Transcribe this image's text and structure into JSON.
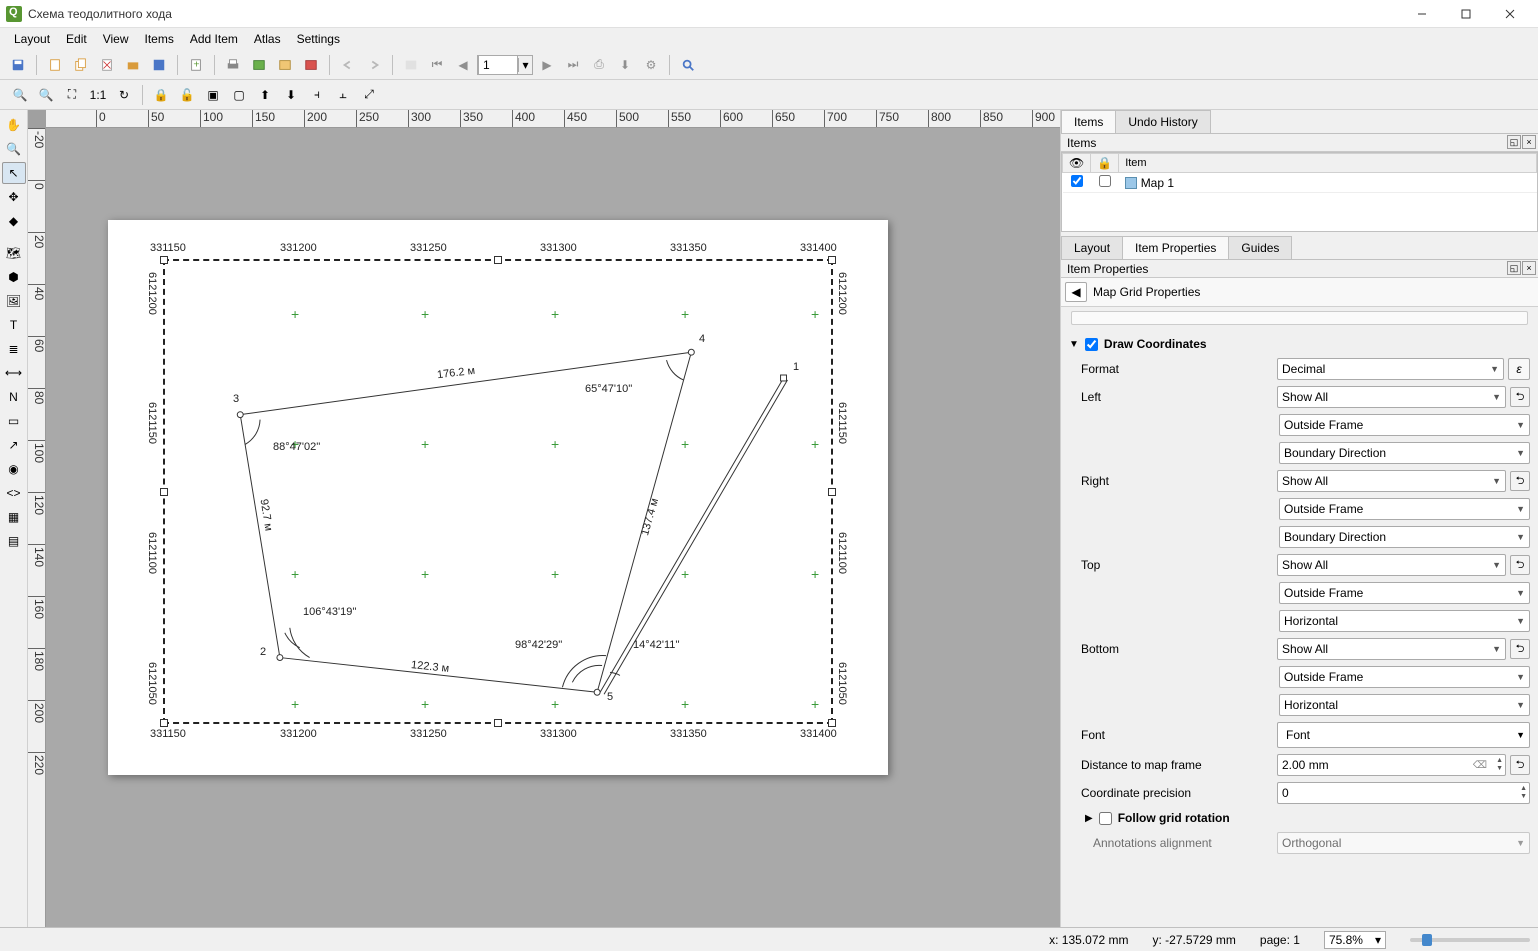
{
  "window": {
    "title": "Схема теодолитного хода"
  },
  "menu": {
    "items": [
      "Layout",
      "Edit",
      "View",
      "Items",
      "Add Item",
      "Atlas",
      "Settings"
    ]
  },
  "page_input": "1",
  "items_panel": {
    "title": "Items",
    "tabs": [
      "Items",
      "Undo History"
    ],
    "columns": {
      "eye": "",
      "lock": "",
      "item": "Item"
    },
    "rows": [
      {
        "visible": true,
        "locked": false,
        "name": "Map 1"
      }
    ]
  },
  "props_panel": {
    "tabs": [
      "Layout",
      "Item Properties",
      "Guides"
    ],
    "title": "Item Properties",
    "breadcrumb": "Map Grid Properties",
    "draw_coords": {
      "header": "Draw Coordinates",
      "checked": true,
      "format_label": "Format",
      "format_value": "Decimal",
      "left_label": "Left",
      "left_show": "Show All",
      "left_pos": "Outside Frame",
      "left_dir": "Boundary Direction",
      "right_label": "Right",
      "right_show": "Show All",
      "right_pos": "Outside Frame",
      "right_dir": "Boundary Direction",
      "top_label": "Top",
      "top_show": "Show All",
      "top_pos": "Outside Frame",
      "top_orient": "Horizontal",
      "bottom_label": "Bottom",
      "bottom_show": "Show All",
      "bottom_pos": "Outside Frame",
      "bottom_orient": "Horizontal",
      "font_label": "Font",
      "font_value": "Font",
      "dist_label": "Distance to map frame",
      "dist_value": "2.00 mm",
      "prec_label": "Coordinate precision",
      "prec_value": "0",
      "follow_rotation": "Follow grid rotation",
      "annot_align_label": "Annotations alignment",
      "annot_align_value": "Orthogonal"
    }
  },
  "map": {
    "coords_top": [
      "331150",
      "331200",
      "331250",
      "331300",
      "331350",
      "331400"
    ],
    "coords_bottom": [
      "331150",
      "331200",
      "331250",
      "331300",
      "331350",
      "331400"
    ],
    "coords_left": [
      "6121200",
      "6121150",
      "6121100",
      "6121050"
    ],
    "coords_right": [
      "6121200",
      "6121150",
      "6121100",
      "6121050"
    ],
    "points": {
      "p1": "1",
      "p2": "2",
      "p3": "3",
      "p4": "4",
      "p5": "5"
    },
    "distances": {
      "d34": "176.2 м",
      "d23": "92.7 м",
      "d25": "122.3 м",
      "d45": "137.4 м"
    },
    "angles": {
      "a3": "88°47'02''",
      "a4": "65°47'10''",
      "a2": "106°43'19''",
      "a5l": "98°42'29''",
      "a5r": "14°42'11''"
    }
  },
  "ruler_h": [
    "0",
    "50",
    "100",
    "150",
    "200",
    "250",
    "300",
    "350",
    "400",
    "450",
    "500",
    "550",
    "600",
    "650",
    "700",
    "750",
    "800",
    "850",
    "900"
  ],
  "ruler_v": [
    "-20",
    "0",
    "20",
    "40",
    "60",
    "80",
    "100",
    "120",
    "140",
    "160",
    "180",
    "200",
    "220"
  ],
  "status": {
    "x": "x: 135.072 mm",
    "y": "y: -27.5729 mm",
    "page": "page: 1",
    "zoom": "75.8%"
  }
}
